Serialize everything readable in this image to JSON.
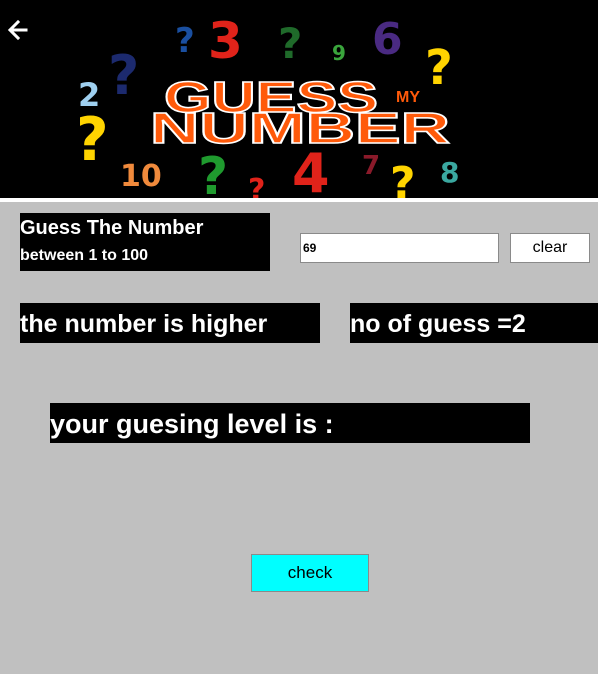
{
  "header": {
    "back_icon": "arrow-left-icon",
    "banner": {
      "word1": "GUESS",
      "word2": "NUMBER",
      "small_word": "MY",
      "decor_numbers": [
        "3",
        "9",
        "6",
        "10",
        "4",
        "7",
        "8",
        "2"
      ],
      "decor_question": "?",
      "colors": {
        "word_fill": "#ff5a0a",
        "word_stroke": "#ffffff",
        "q_yellow": "#ffd400",
        "q_blue": "#1a4fa0",
        "q_darkblue": "#1c2a6e",
        "q_green": "#1f9a2e",
        "q_red": "#e0231a",
        "q_lightblue": "#9fd0f0",
        "num_red": "#e0231a",
        "num_green": "#3aa53c",
        "num_purple": "#4a2a82",
        "num_orange": "#f08a3c",
        "num_teal": "#3aa8a0",
        "num_darkred": "#8a1a2a",
        "small_word": "#ff5a0a"
      }
    }
  },
  "title": {
    "line1": "Guess The Number",
    "line2": "between 1 to 100"
  },
  "guess_input": {
    "value": "69",
    "placeholder": ""
  },
  "clear_button": {
    "label": "clear"
  },
  "hint": {
    "text": "the number is higher"
  },
  "guess_count": {
    "text": "no of guess =2"
  },
  "level": {
    "text": "your guesing level is :"
  },
  "check_button": {
    "label": "check",
    "color": "#00ffff"
  },
  "colors": {
    "background": "#c0c0c0",
    "header_bg": "#000000",
    "label_bg": "#000000",
    "label_text": "#ffffff"
  }
}
